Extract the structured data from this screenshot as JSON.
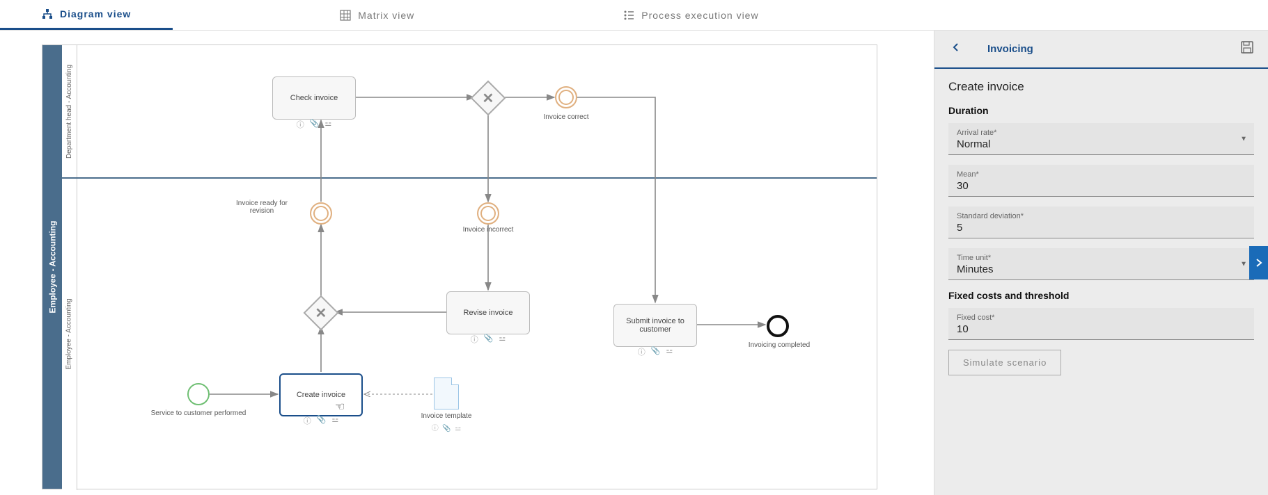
{
  "tabs": {
    "diagram": "Diagram view",
    "matrix": "Matrix view",
    "process": "Process execution view"
  },
  "pool": {
    "name": "Employee - Accounting",
    "lanes": [
      {
        "name": "Department head - Accounting"
      },
      {
        "name": "Employee - Accounting"
      }
    ]
  },
  "nodes": {
    "check_invoice": "Check invoice",
    "invoice_correct": "Invoice correct",
    "invoice_ready": "Invoice ready for revision",
    "invoice_incorrect": "Invoice incorrect",
    "revise_invoice": "Revise invoice",
    "submit_invoice": "Submit invoice to customer",
    "invoicing_completed": "Invoicing completed",
    "create_invoice": "Create invoice",
    "service_performed": "Service to customer performed",
    "invoice_template": "Invoice template"
  },
  "panel": {
    "title": "Invoicing",
    "subtitle": "Create invoice",
    "section_duration": "Duration",
    "arrival_rate_label": "Arrival rate*",
    "arrival_rate_value": "Normal",
    "mean_label": "Mean*",
    "mean_value": "30",
    "stddev_label": "Standard deviation*",
    "stddev_value": "5",
    "timeunit_label": "Time unit*",
    "timeunit_value": "Minutes",
    "section_costs": "Fixed costs and threshold",
    "fixedcost_label": "Fixed cost*",
    "fixedcost_value": "10",
    "simulate_button": "Simulate scenario"
  }
}
